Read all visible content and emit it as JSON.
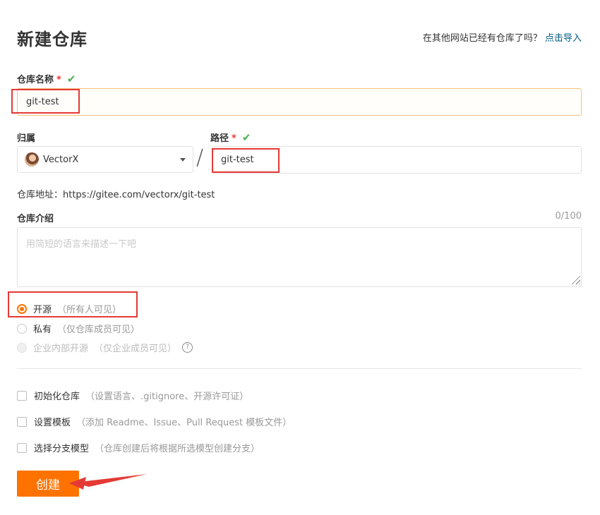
{
  "header": {
    "title": "新建仓库",
    "import_prompt": "在其他网站已经有仓库了吗？",
    "import_link": "点击导入"
  },
  "repo_name": {
    "label": "仓库名称",
    "required_mark": "*",
    "valid_icon": "check-icon",
    "value": "git-test"
  },
  "owner": {
    "label": "归属",
    "value": "VectorX"
  },
  "separator": "/",
  "path": {
    "label": "路径",
    "required_mark": "*",
    "valid_icon": "check-icon",
    "value": "git-test"
  },
  "repo_address": "仓库地址：https://gitee.com/vectorx/git-test",
  "description": {
    "label": "仓库介绍",
    "counter": "0/100",
    "placeholder": "用简短的语言来描述一下吧",
    "value": ""
  },
  "visibility": {
    "options": [
      {
        "label": "开源",
        "hint": "（所有人可见）",
        "selected": true
      },
      {
        "label": "私有",
        "hint": "（仅仓库成员可见）",
        "selected": false
      },
      {
        "label": "企业内部开源",
        "hint": "（仅企业成员可见）",
        "selected": false,
        "disabled": true
      }
    ]
  },
  "options": [
    {
      "label": "初始化仓库",
      "hint": "（设置语言、.gitignore、开源许可证）",
      "checked": false
    },
    {
      "label": "设置模板",
      "hint": "（添加 Readme、Issue、Pull Request 模板文件）",
      "checked": false
    },
    {
      "label": "选择分支模型",
      "hint": "（仓库创建后将根据所选模型创建分支）",
      "checked": false
    }
  ],
  "submit": {
    "label": "创建"
  },
  "colors": {
    "accent": "#fe7300",
    "check": "#4caf50",
    "required": "#e33333",
    "annotation": "#e53935",
    "link": "#005980"
  }
}
